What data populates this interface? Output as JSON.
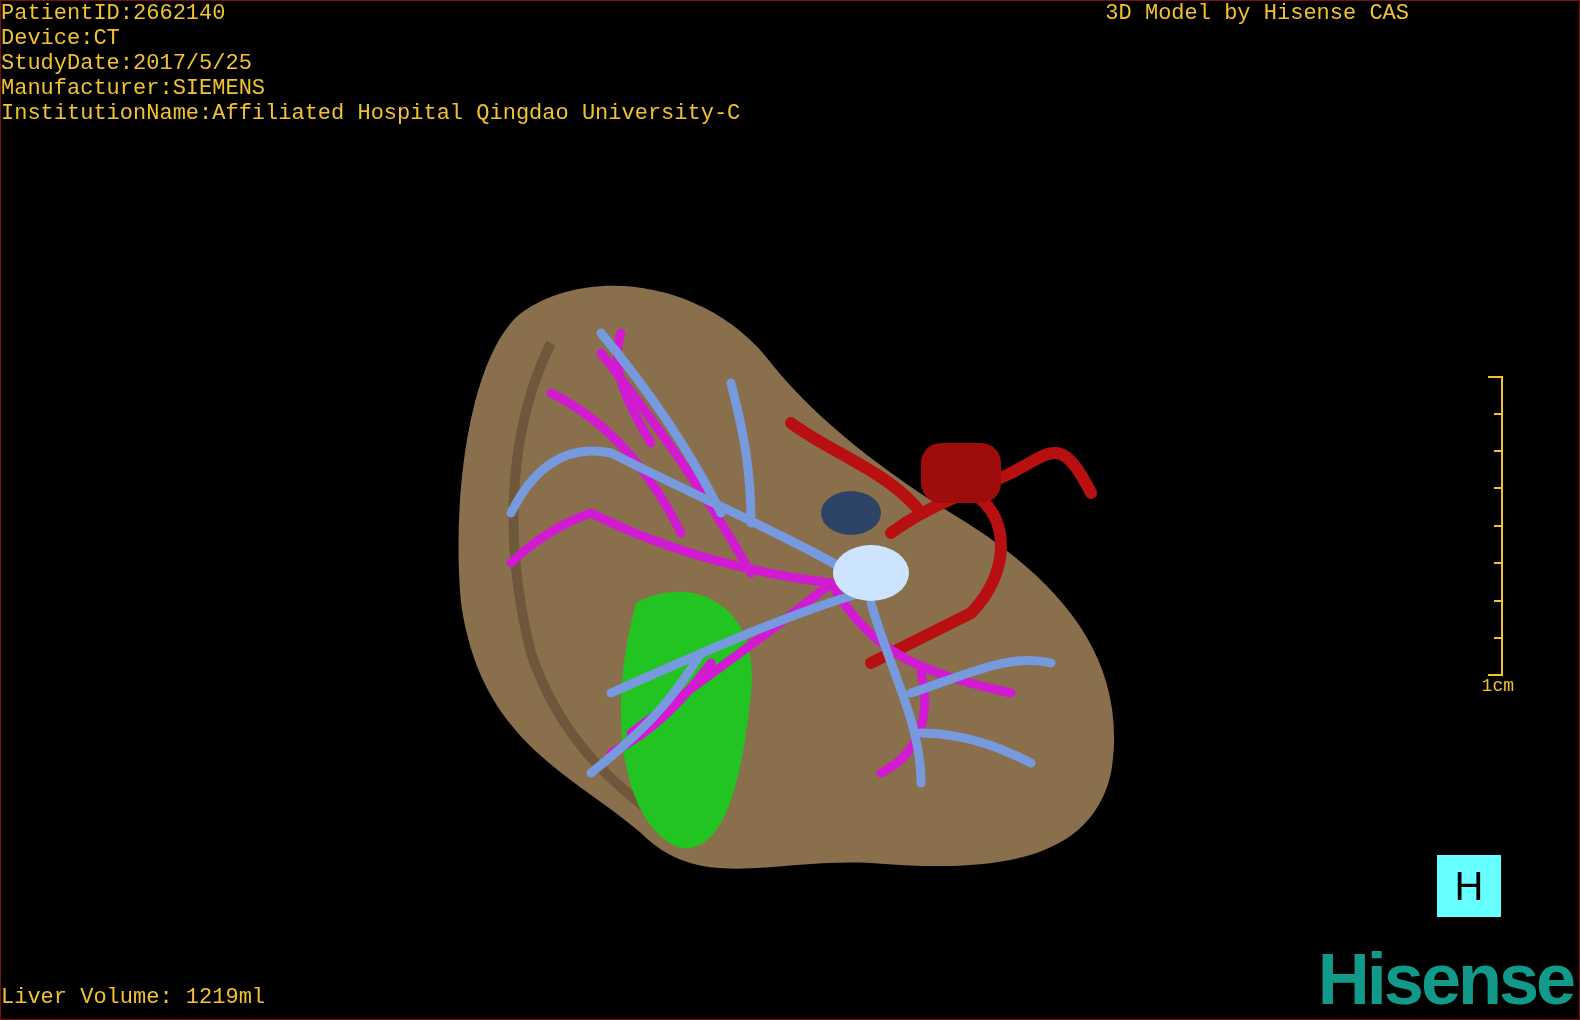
{
  "info_lines": [
    "PatientID:2662140",
    "Device:CT",
    "StudyDate:2017/5/25",
    "Manufacturer:SIEMENS",
    "InstitutionName:Affiliated Hospital Qingdao University-C"
  ],
  "credit": "3D Model by Hisense CAS",
  "scale_bar": {
    "label": "1cm"
  },
  "orientation_marker": {
    "label": "H"
  },
  "volume": "Liver Volume: 1219ml",
  "logo": "Hisense"
}
